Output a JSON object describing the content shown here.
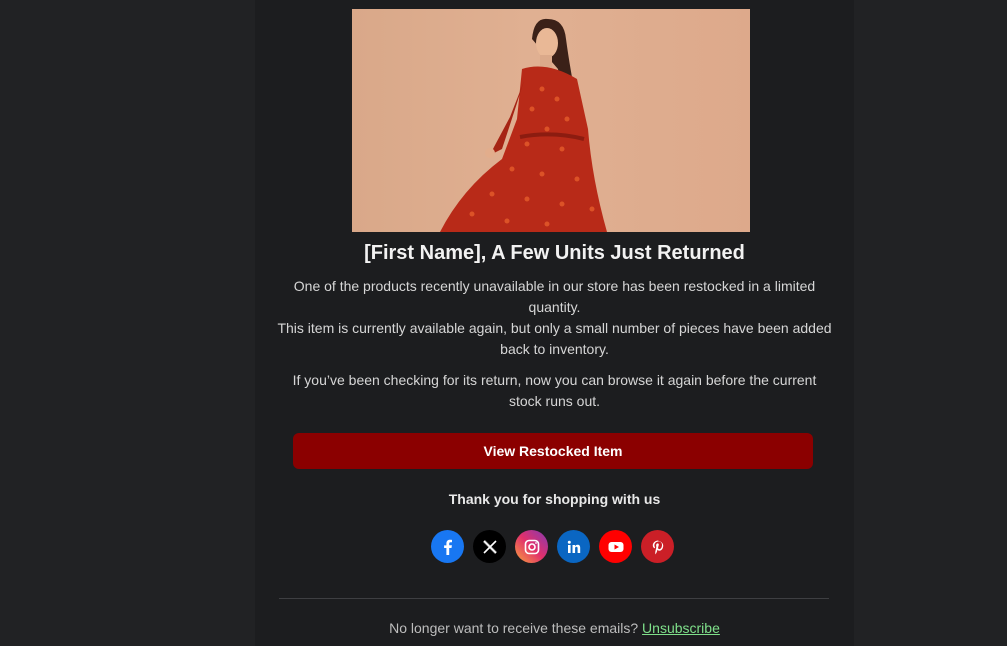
{
  "email": {
    "headline": "[First Name], A Few Units Just Returned",
    "paragraph1_line1": "One of the products recently unavailable in our store has been restocked in a limited quantity.",
    "paragraph1_line2": "This item is currently available again, but only a small number of pieces have been added back to inventory.",
    "paragraph2": "If you’ve been checking for its return, now you can browse it again before the current stock runs out.",
    "cta_label": "View Restocked Item",
    "thanks": "Thank you for shopping with us",
    "footer_text": "No longer want to receive these emails?",
    "unsubscribe_label": "Unsubscribe"
  },
  "social": [
    {
      "icon": "facebook-icon",
      "color": "#1877f2"
    },
    {
      "icon": "x-icon",
      "color": "#000000"
    },
    {
      "icon": "instagram-icon",
      "color": "#d6249f"
    },
    {
      "icon": "linkedin-icon",
      "color": "#0a66c2"
    },
    {
      "icon": "youtube-icon",
      "color": "#ff0000"
    },
    {
      "icon": "pinterest-icon",
      "color": "#cb1f27"
    }
  ],
  "colors": {
    "page_bg": "#212224",
    "card_bg": "#1c1d1f",
    "cta_bg": "#8b0000",
    "link": "#7fe08a"
  }
}
